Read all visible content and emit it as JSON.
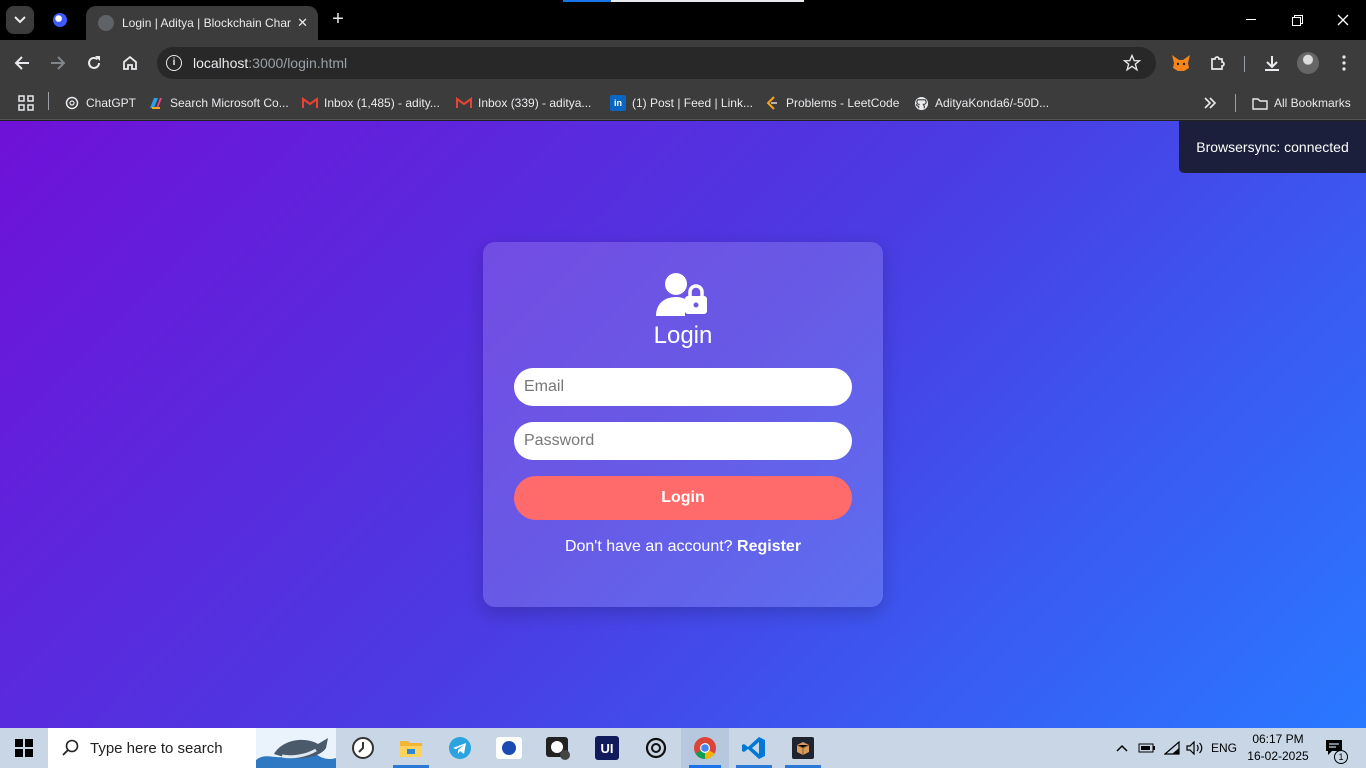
{
  "browser": {
    "tab_title": "Login | Aditya | Blockchain Char",
    "url_host": "localhost",
    "url_rest": ":3000/login.html"
  },
  "bookmarks": [
    {
      "label": "ChatGPT",
      "icon": "chatgpt-icon"
    },
    {
      "label": "Search Microsoft Co...",
      "icon": "copilot-icon"
    },
    {
      "label": "Inbox (1,485) - adity...",
      "icon": "gmail-icon"
    },
    {
      "label": "Inbox (339) - aditya...",
      "icon": "gmail-icon"
    },
    {
      "label": "(1) Post | Feed | Link...",
      "icon": "linkedin-icon"
    },
    {
      "label": "Problems - LeetCode",
      "icon": "leetcode-icon"
    },
    {
      "label": "AdityaKonda6/-50D...",
      "icon": "github-icon"
    }
  ],
  "all_bookmarks_label": "All Bookmarks",
  "toast": "Browsersync: connected",
  "login": {
    "title": "Login",
    "email_placeholder": "Email",
    "password_placeholder": "Password",
    "button_label": "Login",
    "prompt": "Don't have an account?",
    "register_label": "Register"
  },
  "colors": {
    "gradient_start": "#6f11d8",
    "gradient_end": "#2979ff",
    "button": "#ff6b6b"
  },
  "taskbar": {
    "search_placeholder": "Type here to search",
    "language": "ENG",
    "time": "06:17 PM",
    "date": "16-02-2025",
    "notification_count": "1"
  }
}
